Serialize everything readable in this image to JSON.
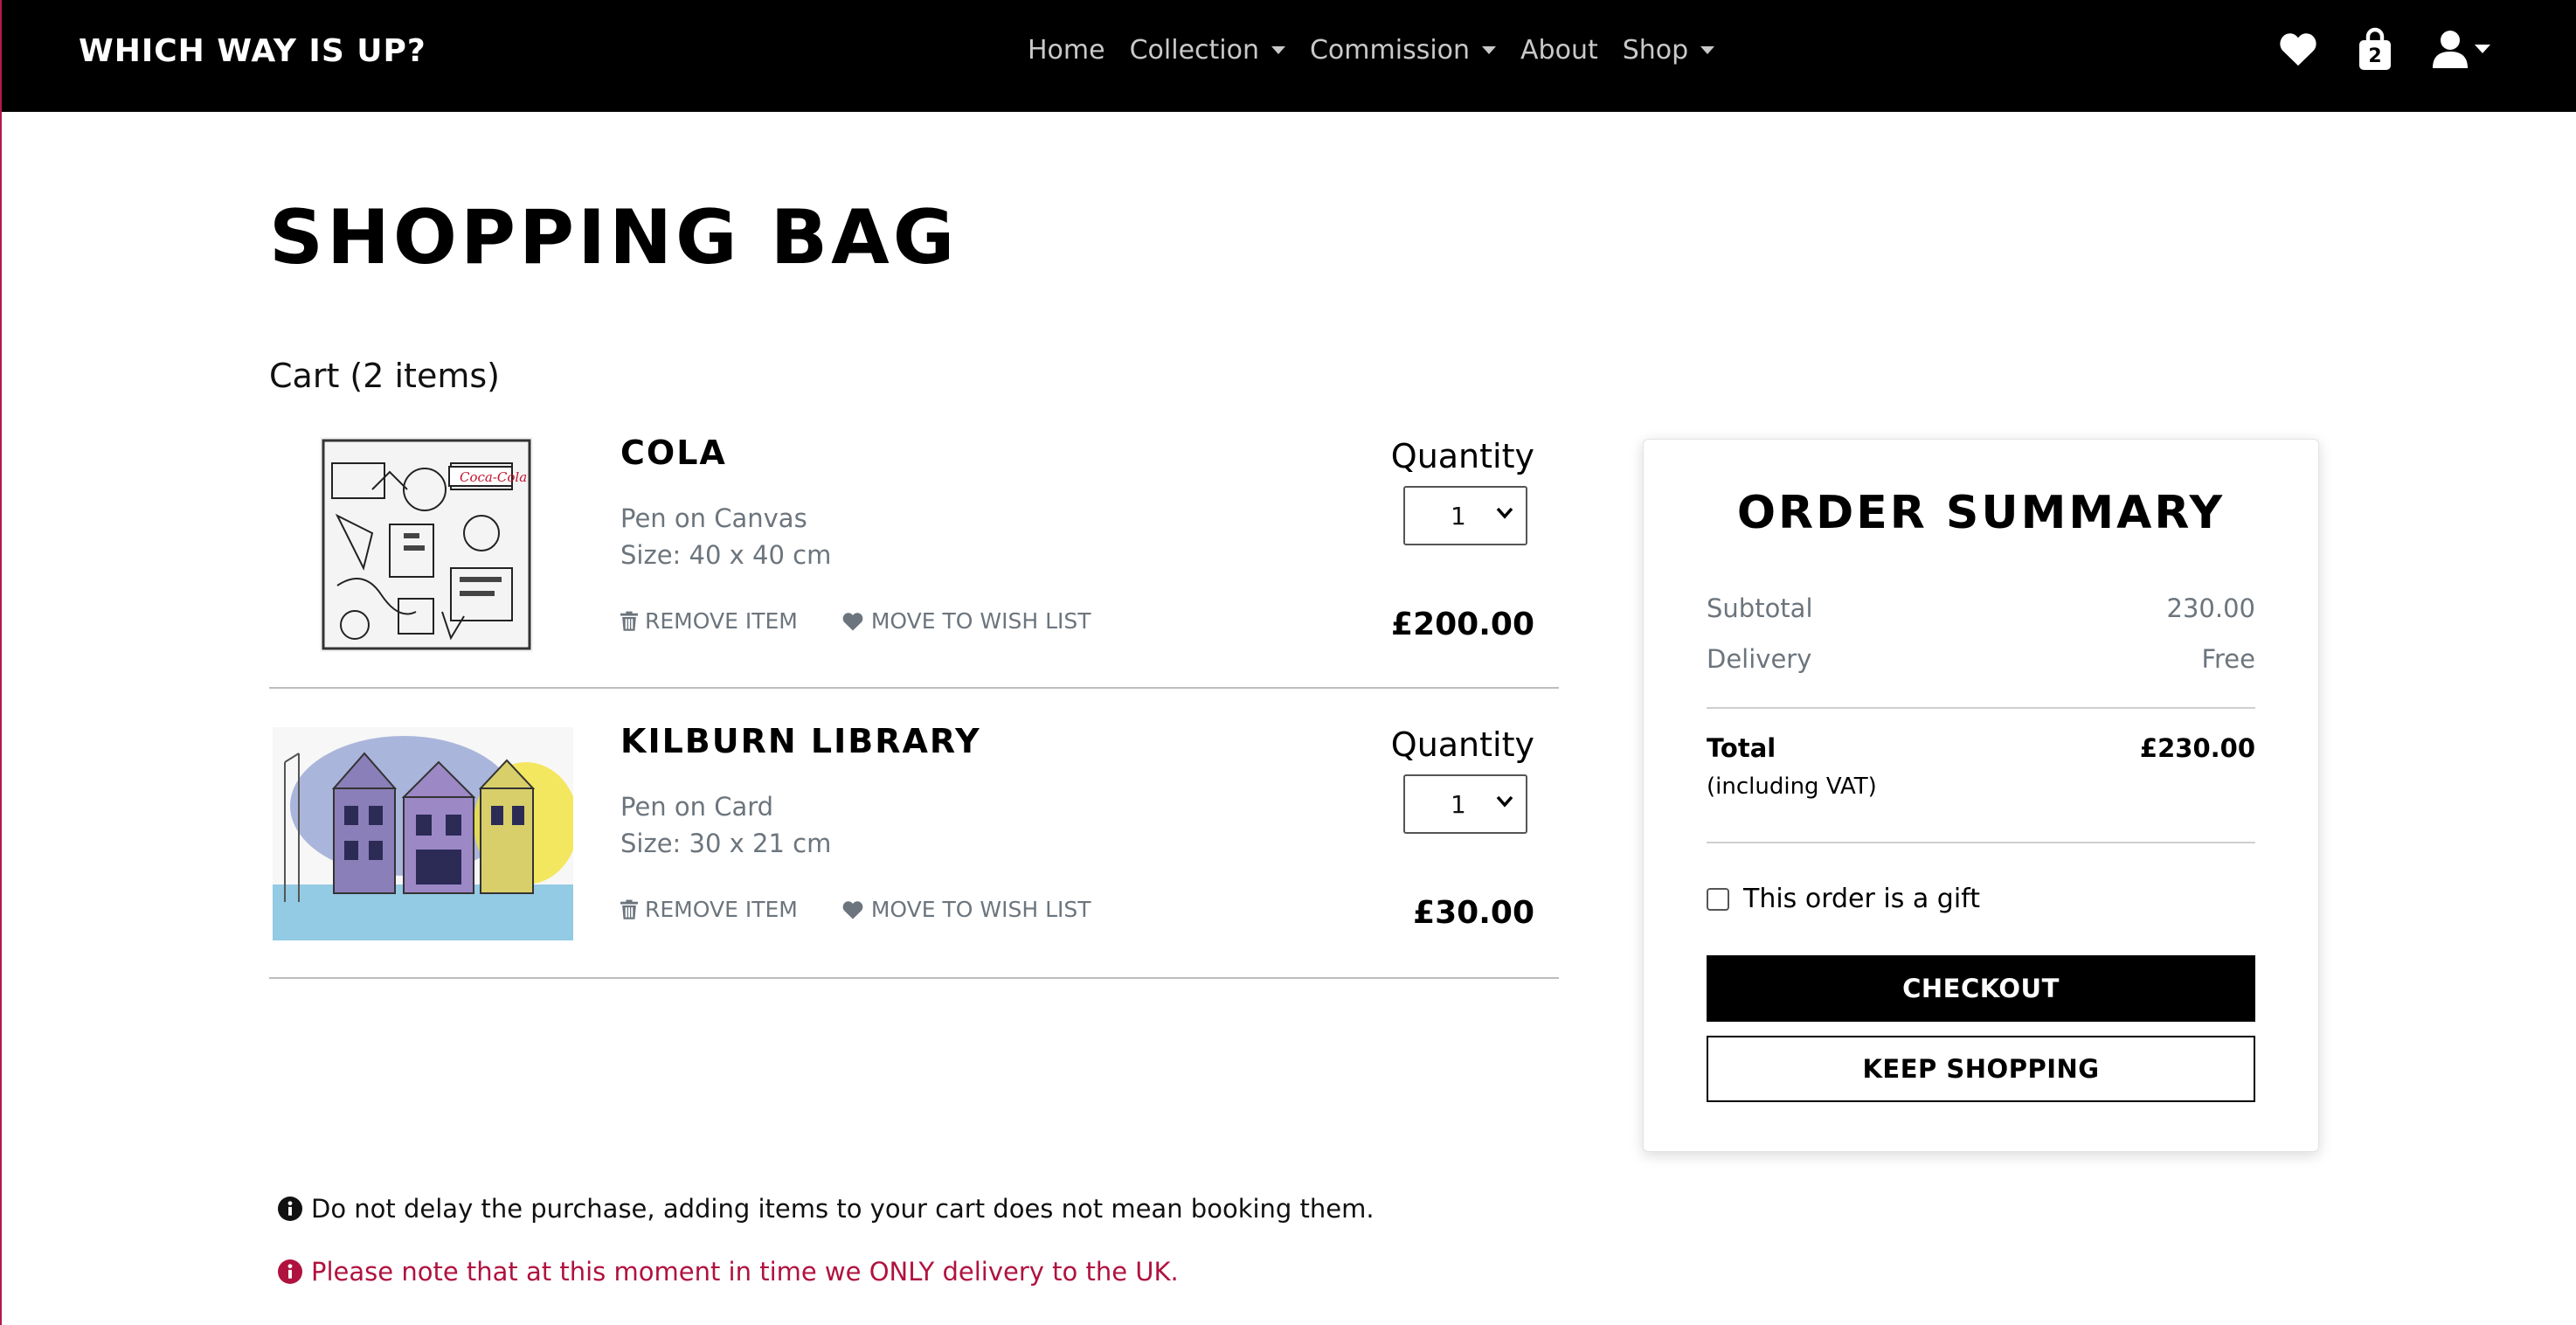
{
  "nav": {
    "brand": "WHICH WAY IS UP?",
    "items": [
      {
        "label": "Home",
        "dropdown": false
      },
      {
        "label": "Collection",
        "dropdown": true
      },
      {
        "label": "Commission",
        "dropdown": true
      },
      {
        "label": "About",
        "dropdown": false
      },
      {
        "label": "Shop",
        "dropdown": true
      }
    ],
    "icons": {
      "wishlist": "heart-icon",
      "bag": "shopping-bag-icon",
      "account": "user-icon"
    },
    "bag_count": "2"
  },
  "page": {
    "title": "SHOPPING BAG",
    "cart_count": "Cart (2 items)"
  },
  "cart": {
    "items": [
      {
        "name": "COLA",
        "medium": "Pen on Canvas",
        "size": "Size: 40 x 40 cm",
        "remove_label": "REMOVE ITEM",
        "wishlist_label": "MOVE TO WISH LIST",
        "quantity_label": "Quantity",
        "quantity": "1",
        "price": "£200.00"
      },
      {
        "name": "KILBURN LIBRARY",
        "medium": "Pen on Card",
        "size": "Size: 30 x 21 cm",
        "remove_label": "REMOVE ITEM",
        "wishlist_label": "MOVE TO WISH LIST",
        "quantity_label": "Quantity",
        "quantity": "1",
        "price": "£30.00"
      }
    ]
  },
  "summary": {
    "title": "ORDER SUMMARY",
    "subtotal_label": "Subtotal",
    "subtotal_value": "230.00",
    "delivery_label": "Delivery",
    "delivery_value": "Free",
    "total_label": "Total",
    "total_value": "£230.00",
    "vat_note": "(including VAT)",
    "gift_label": "This order is a gift",
    "gift_checked": false,
    "checkout_label": "CHECKOUT",
    "keep_shopping_label": "KEEP SHOPPING"
  },
  "notes": {
    "info": "Do not delay the purchase, adding items to your cart does not mean booking them.",
    "warning": "Please note that at this moment in time we ONLY delivery to the UK."
  },
  "colors": {
    "navbar": "#000000",
    "warning": "#b0123f",
    "muted": "#6c757d"
  }
}
